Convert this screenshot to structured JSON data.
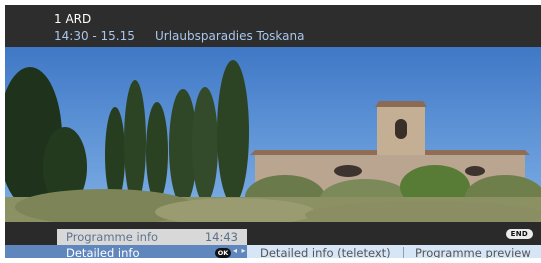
{
  "channel": {
    "number_name": "1  ARD",
    "time": "14:30 - 15.15",
    "programme_title": "Urlaubsparadies Toskana"
  },
  "picture": {
    "description_icon": "tuscany-landscape-image"
  },
  "controls": {
    "end_label": "END"
  },
  "popup": {
    "title": "Programme info",
    "time": "14:43"
  },
  "options": {
    "selected": "Detailed info",
    "ok_label": "OK",
    "arrows": "◂ ▸",
    "item2": "Detailed info (teletext)",
    "item3": "Programme preview"
  },
  "colors": {
    "accent": "#5f87bd",
    "info_text": "#a9c7ec",
    "bar_light": "#d7e6f7"
  }
}
